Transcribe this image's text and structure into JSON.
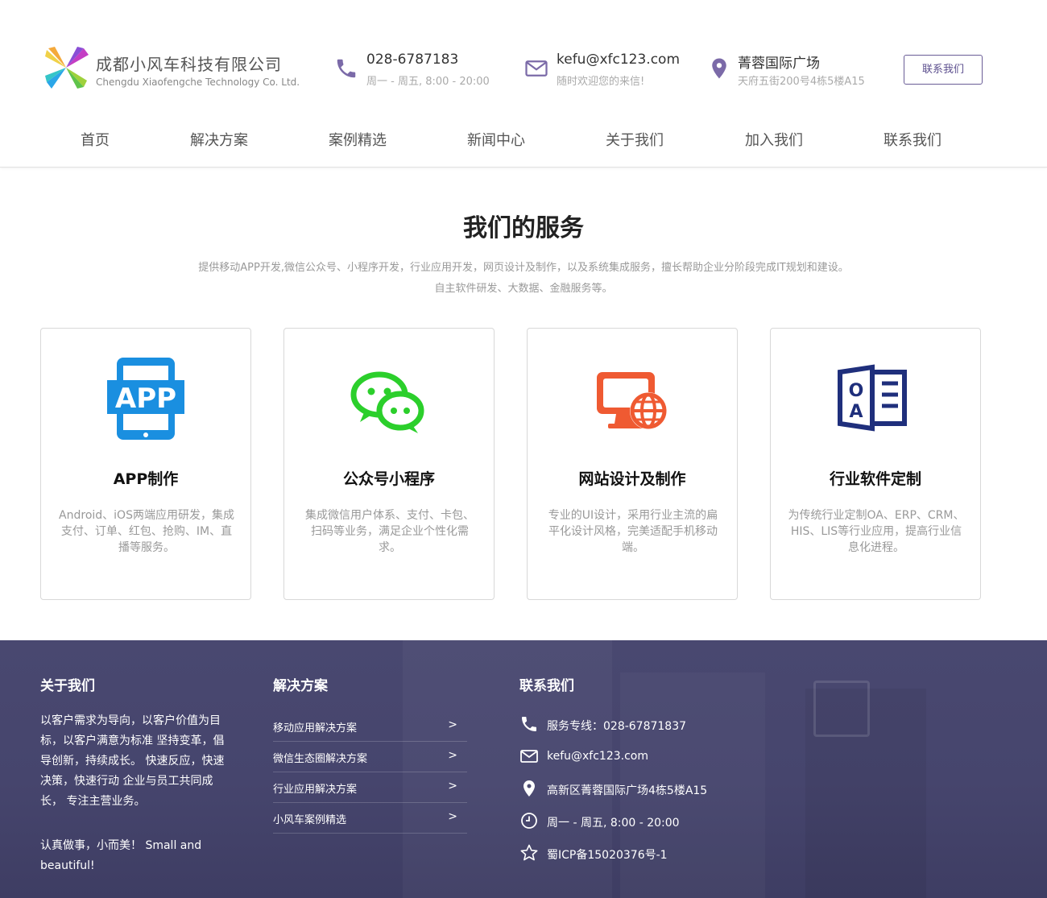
{
  "header": {
    "brand_cn": "成都小风车科技有限公司",
    "brand_en": "Chengdu Xiaofengche Technology Co. Ltd.",
    "phone": {
      "main": "028-6787183",
      "sub": "周一 - 周五, 8:00 - 20:00",
      "icon": "phone-icon"
    },
    "email": {
      "main": "kefu@xfc123.com",
      "sub": "随时欢迎您的来信!",
      "icon": "mail-icon"
    },
    "address": {
      "main": "菁蓉国际广场",
      "sub": "天府五街200号4栋5楼A15",
      "icon": "location-pin-icon"
    },
    "contact_button": "联系我们",
    "accent_color": "#7b6aa8"
  },
  "nav": {
    "items": [
      {
        "label": "首页"
      },
      {
        "label": "解决方案"
      },
      {
        "label": "案例精选"
      },
      {
        "label": "新闻中心"
      },
      {
        "label": "关于我们"
      },
      {
        "label": "加入我们"
      },
      {
        "label": "联系我们"
      }
    ]
  },
  "services": {
    "title": "我们的服务",
    "desc_line1": "提供移动APP开发,微信公众号、小程序开发，行业应用开发，网页设计及制作，以及系统集成服务，擅长帮助企业分阶段完成IT规划和建设。",
    "desc_line2": "自主软件研发、大数据、金融服务等。",
    "cards": [
      {
        "title": "APP制作",
        "desc": "Android、iOS两端应用研发，集成支付、订单、红包、抢购、IM、直播等服务。",
        "icon": "app-tablet-icon",
        "color": "#1a8fe0"
      },
      {
        "title": "公众号小程序",
        "desc": "集成微信用户体系、支付、卡包、扫码等业务，满足企业个性化需求。",
        "icon": "wechat-icon",
        "color": "#2bcf2b"
      },
      {
        "title": "网站设计及制作",
        "desc": "专业的UI设计，采用行业主流的扁平化设计风格，完美适配手机移动端。",
        "icon": "monitor-globe-icon",
        "color": "#ef5a32"
      },
      {
        "title": "行业软件定制",
        "desc": "为传统行业定制OA、ERP、CRM、HIS、LIS等行业应用，提高行业信息化进程。",
        "icon": "oa-document-icon",
        "color": "#1f2f7c"
      }
    ]
  },
  "footer": {
    "about_title": "关于我们",
    "about_text": "以客户需求为导向，以客户价值为目标，以客户满意为标准 坚持变革，倡导创新，持续成长。 快速反应，快速决策，快速行动 企业与员工共同成长， 专注主营业务。",
    "motto": "认真做事，小而美！ Small and beautiful!",
    "solutions_title": "解决方案",
    "solutions": [
      {
        "label": "移动应用解决方案",
        "arrow": ">"
      },
      {
        "label": "微信生态圈解决方案",
        "arrow": ">"
      },
      {
        "label": "行业应用解决方案",
        "arrow": ">"
      },
      {
        "label": "小风车案例精选",
        "arrow": ">"
      }
    ],
    "contact_title": "联系我们",
    "contact_items": [
      {
        "text": "服务专线：028-67871837",
        "icon": "phone-icon"
      },
      {
        "text": "kefu@xfc123.com",
        "icon": "mail-icon"
      },
      {
        "text": "高新区菁蓉国际广场4栋5楼A15",
        "icon": "location-pin-icon"
      },
      {
        "text": "周一 - 周五, 8:00 - 20:00",
        "icon": "clock-icon"
      },
      {
        "text": "蜀ICP备15020376号-1",
        "icon": "star-icon"
      }
    ],
    "bg_color": "#46456d"
  }
}
